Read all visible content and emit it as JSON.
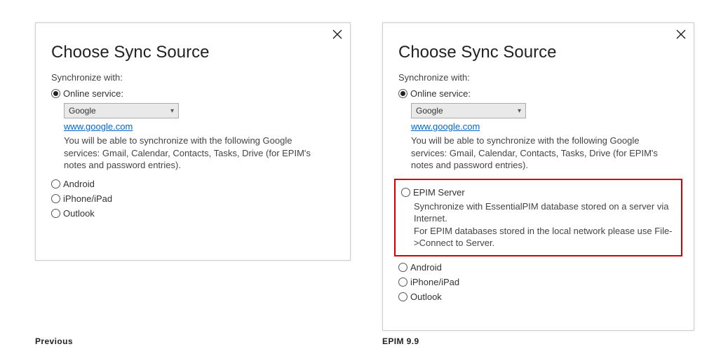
{
  "left": {
    "title": "Choose Sync Source",
    "subhead": "Synchronize with:",
    "online_label": "Online service:",
    "select_value": "Google",
    "link": "www.google.com",
    "desc": "You will be able to synchronize with the following Google services: Gmail, Calendar, Contacts, Tasks, Drive (for EPIM's notes and password entries).",
    "opt_android": "Android",
    "opt_iphone": "iPhone/iPad",
    "opt_outlook": "Outlook",
    "caption": "Previous"
  },
  "right": {
    "title": "Choose Sync Source",
    "subhead": "Synchronize with:",
    "online_label": "Online service:",
    "select_value": "Google",
    "link": "www.google.com",
    "desc": "You will be able to synchronize with the following Google services: Gmail, Calendar, Contacts, Tasks, Drive (for EPIM's notes and password entries).",
    "epim_label": "EPIM Server",
    "epim_desc1": "Synchronize with EssentialPIM database stored on a server via Internet.",
    "epim_desc2": "For EPIM databases stored in the local network please use File->Connect to Server.",
    "opt_android": "Android",
    "opt_iphone": "iPhone/iPad",
    "opt_outlook": "Outlook",
    "caption": "EPIM 9.9"
  }
}
